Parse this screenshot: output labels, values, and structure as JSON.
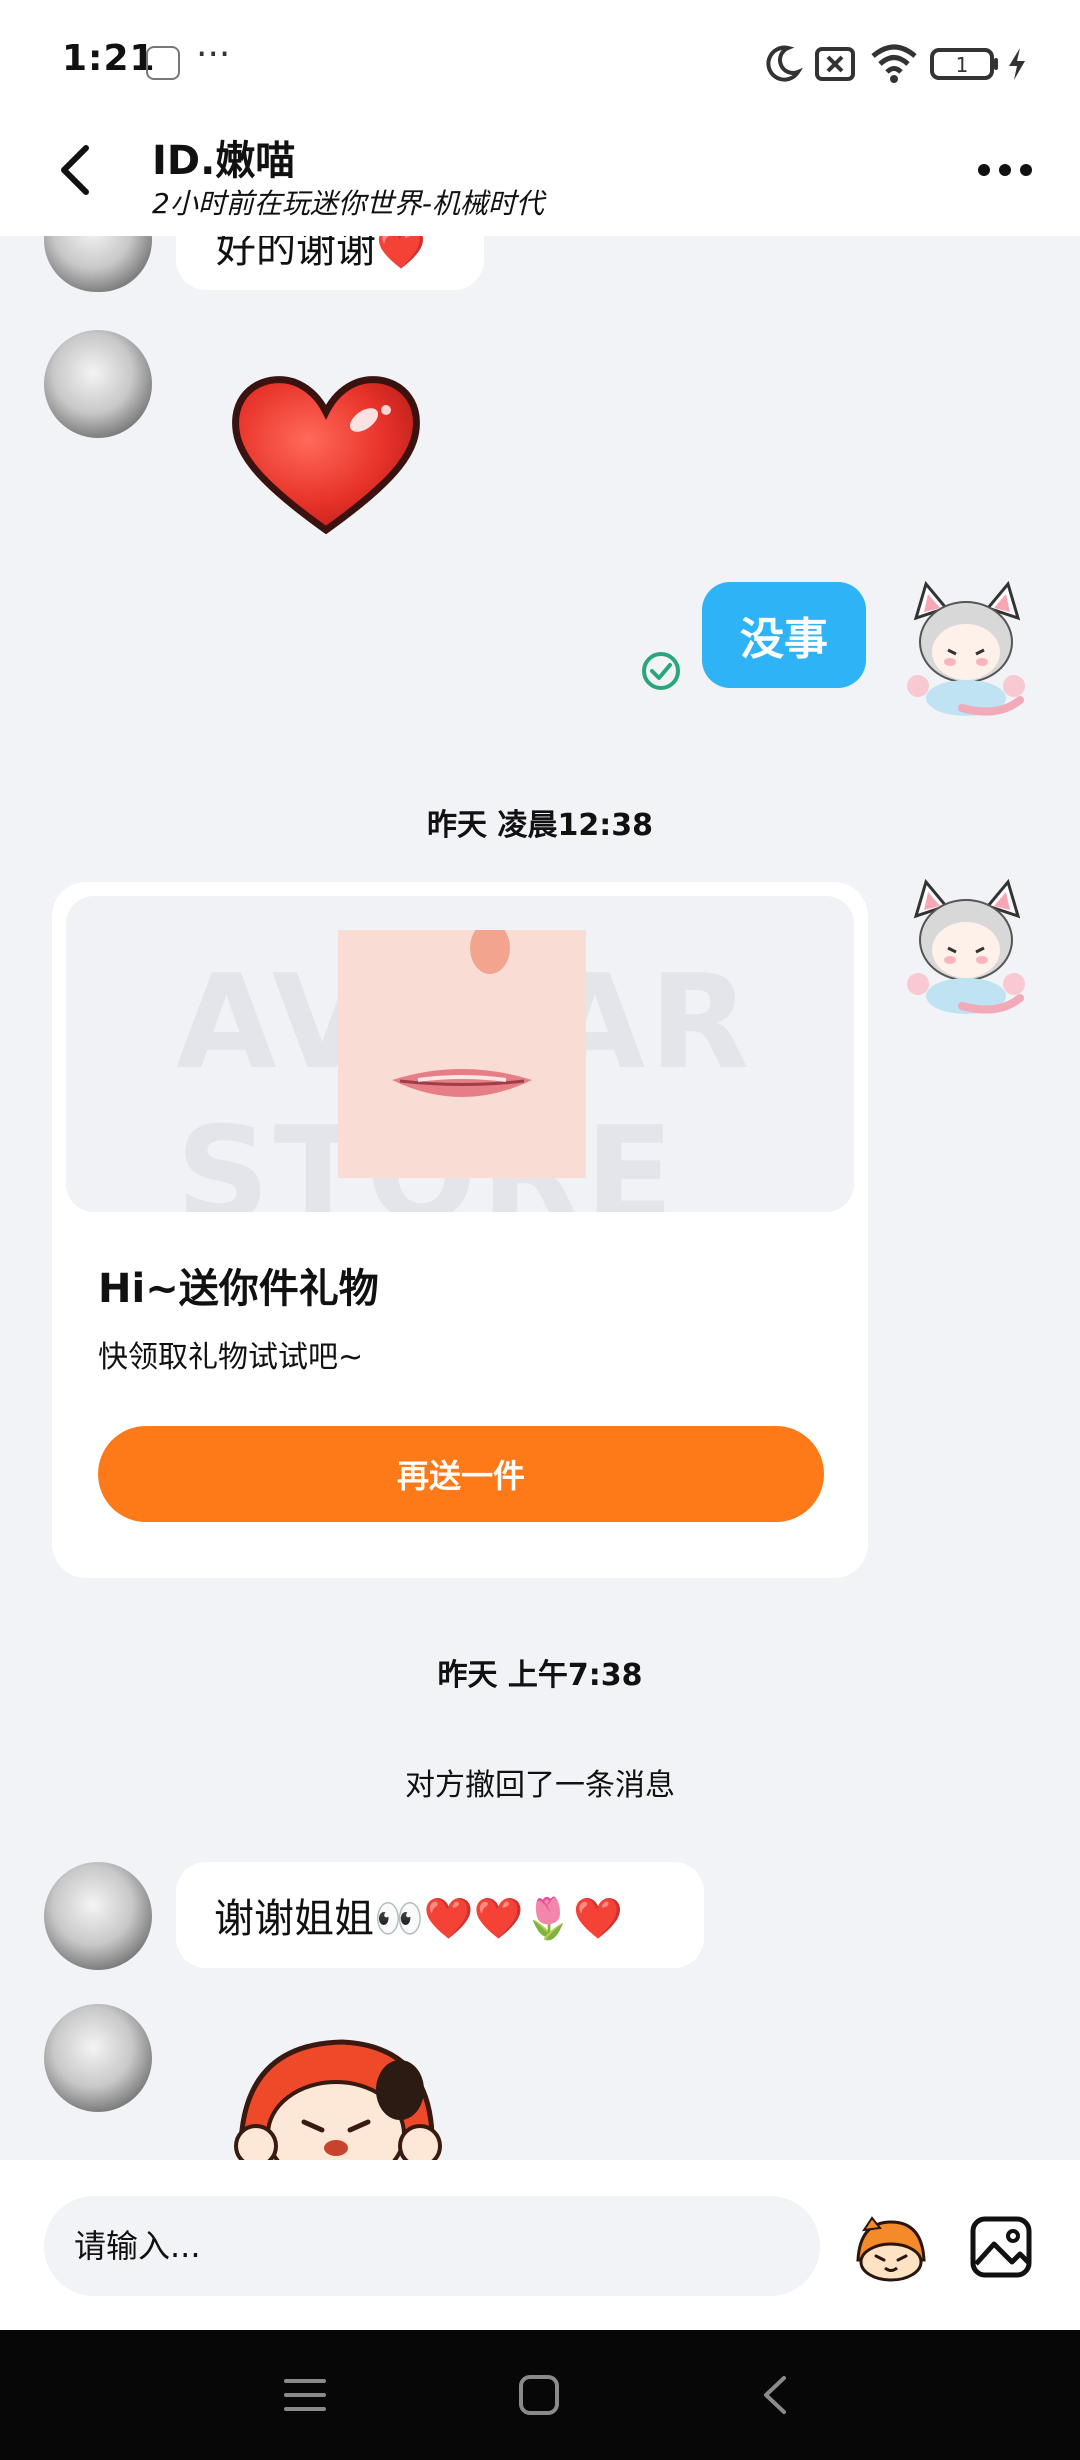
{
  "status_bar": {
    "time": "1:21",
    "more": "···",
    "icons": [
      "app-notification-icon",
      "moon-icon",
      "sim-blocked-icon",
      "wifi-icon",
      "battery-icon",
      "charging-icon"
    ],
    "battery": {
      "label": "1",
      "level": 0.05
    }
  },
  "header": {
    "title": "ID.嫩喵",
    "subtitle": "2小时前在玩迷你世界-机械时代",
    "back_icon": "chevron-left-icon",
    "more_icon": "more-dots-icon"
  },
  "messages": {
    "partial_text": "好的谢谢❤️",
    "reply_text": "没事",
    "reply_status_icon": "check-circle-icon",
    "stickers": [
      "red-heart-sticker",
      "orange-cat-sticker"
    ],
    "timestamp_1": "昨天 凌晨12:38",
    "gift": {
      "watermark": "AVATAR STORE",
      "title": "Hi~送你件礼物",
      "description": "快领取礼物试试吧~",
      "button": "再送一件"
    },
    "timestamp_2": "昨天 上午7:38",
    "recall_notice": "对方撤回了一条消息",
    "thanks_text": "谢谢姐姐👀❤️❤️🌷❤️"
  },
  "input_bar": {
    "placeholder": "请输入...",
    "emoji_icon": "emoji-mascot-icon",
    "image_icon": "image-icon"
  },
  "nav_bar": {
    "icons": [
      "menu-icon",
      "home-icon",
      "back-icon"
    ]
  },
  "colors": {
    "accent_blue": "#2eb4f6",
    "gift_button": "#fe7a19",
    "check_green": "#2aa77a",
    "chat_background": "#f2f3f7"
  }
}
